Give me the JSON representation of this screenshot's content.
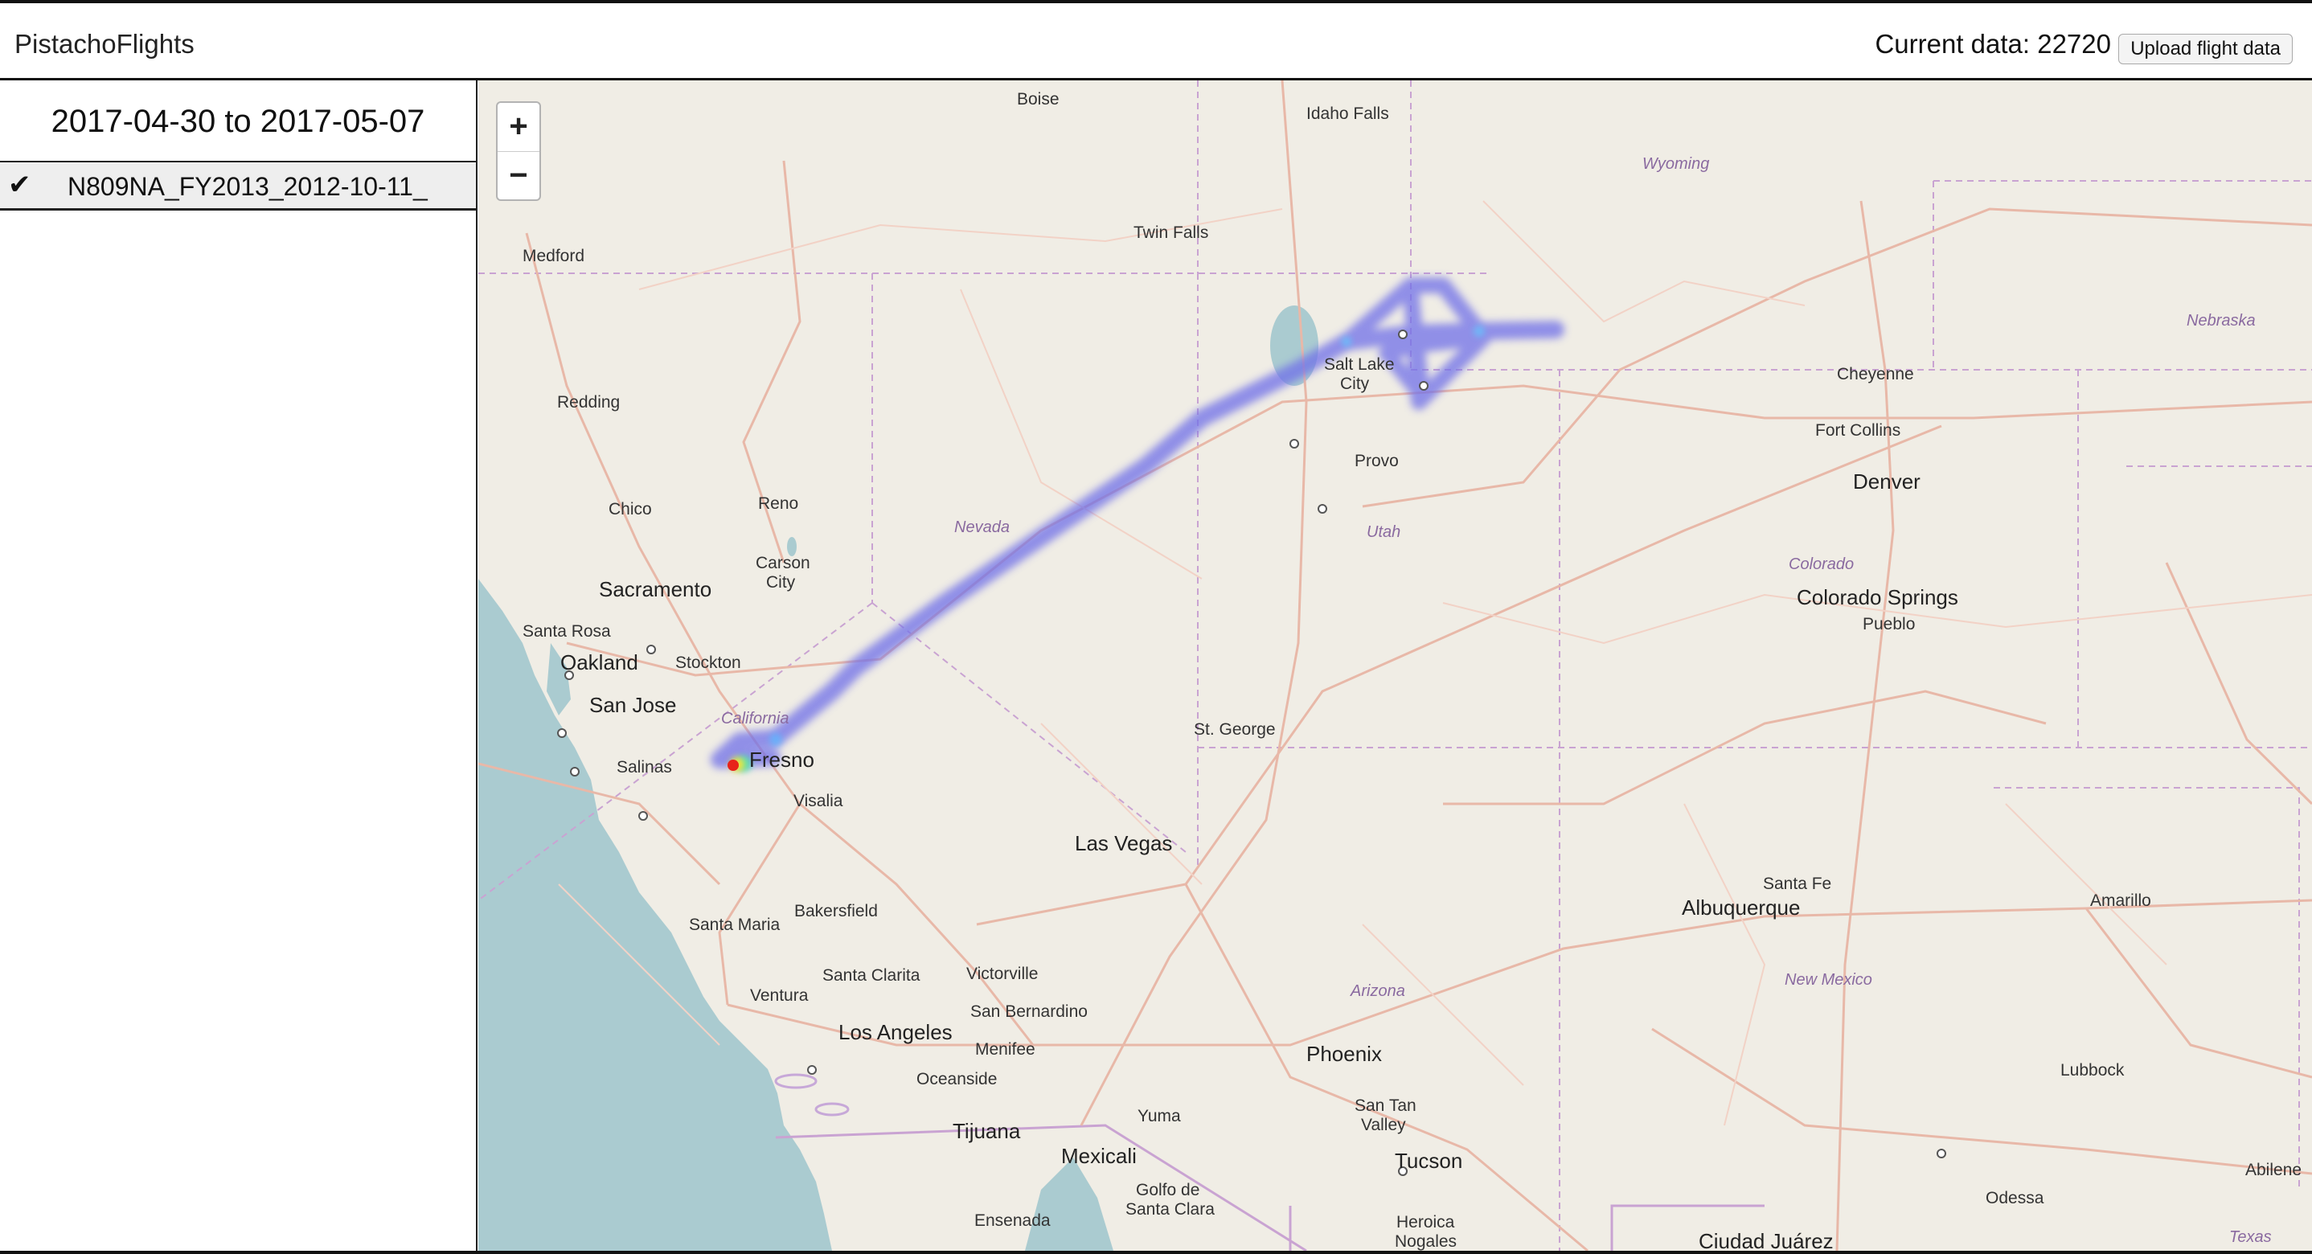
{
  "app": {
    "title": "PistachoFlights",
    "current_data_label": "Current data: 22720",
    "upload_button": "Upload flight data"
  },
  "sidebar": {
    "date_range": "2017-04-30 to 2017-05-07",
    "flights": [
      {
        "label": "N809NA_FY2013_2012-10-11_",
        "selected": true,
        "icon": "check-icon"
      }
    ]
  },
  "map": {
    "zoom_in_label": "+",
    "zoom_out_label": "−",
    "heatmap_color": "#6f6fe8",
    "hotspot_color": "#e8231a",
    "water_color": "#aacbd0",
    "land_color": "#f0ede5",
    "labels": {
      "boise": "Boise",
      "idaho_falls": "Idaho Falls",
      "wyoming": "Wyoming",
      "twin_falls": "Twin Falls",
      "medford": "Medford",
      "nebraska": "Nebraska",
      "salt_lake_city_1": "Salt Lake",
      "salt_lake_city_2": "City",
      "cheyenne": "Cheyenne",
      "redding": "Redding",
      "fort_collins": "Fort Collins",
      "provo": "Provo",
      "denver": "Denver",
      "chico": "Chico",
      "reno": "Reno",
      "nevada": "Nevada",
      "utah": "Utah",
      "carson_city_1": "Carson",
      "carson_city_2": "City",
      "colorado": "Colorado",
      "sacramento": "Sacramento",
      "colorado_springs": "Colorado Springs",
      "santa_rosa": "Santa Rosa",
      "pueblo": "Pueblo",
      "oakland": "Oakland",
      "stockton": "Stockton",
      "san_jose": "San Jose",
      "california": "California",
      "salinas": "Salinas",
      "fresno": "Fresno",
      "st_george": "St. George",
      "visalia": "Visalia",
      "las_vegas": "Las Vegas",
      "santa_fe": "Santa Fe",
      "amarillo": "Amarillo",
      "bakersfield": "Bakersfield",
      "albuquerque": "Albuquerque",
      "santa_maria": "Santa Maria",
      "santa_clarita": "Santa Clarita",
      "victorville": "Victorville",
      "new_mexico": "New Mexico",
      "arizona": "Arizona",
      "ventura": "Ventura",
      "san_bernardino": "San Bernardino",
      "los_angeles": "Los Angeles",
      "menifee": "Menifee",
      "phoenix": "Phoenix",
      "oceanside": "Oceanside",
      "lubbock": "Lubbock",
      "san_tan_valley_1": "San Tan",
      "san_tan_valley_2": "Valley",
      "yuma": "Yuma",
      "tijuana": "Tijuana",
      "mexicali": "Mexicali",
      "tucson": "Tucson",
      "abilene": "Abilene",
      "odessa": "Odessa",
      "golfo_1": "Golfo de",
      "golfo_2": "Santa Clara",
      "heroica_1": "Heroica",
      "heroica_2": "Nogales",
      "ensenada": "Ensenada",
      "ciudad_juarez": "Ciudad Juárez",
      "texas": "Texas"
    }
  }
}
